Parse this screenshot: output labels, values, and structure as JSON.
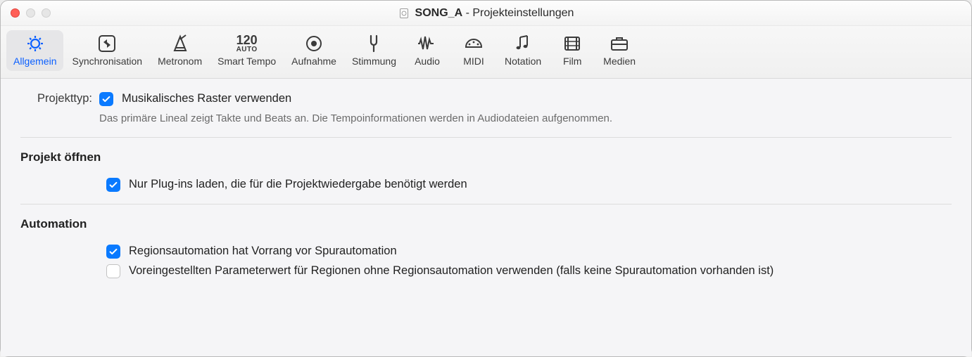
{
  "window": {
    "doc_name": "SONG_A",
    "separator": " - ",
    "title": "Projekteinstellungen"
  },
  "toolbar": {
    "items": [
      {
        "id": "general",
        "label": "Allgemein",
        "active": true
      },
      {
        "id": "sync",
        "label": "Synchronisation",
        "active": false
      },
      {
        "id": "metro",
        "label": "Metronom",
        "active": false
      },
      {
        "id": "smart",
        "label": "Smart Tempo",
        "active": false,
        "topText": "120",
        "subText": "AUTO"
      },
      {
        "id": "record",
        "label": "Aufnahme",
        "active": false
      },
      {
        "id": "tuning",
        "label": "Stimmung",
        "active": false
      },
      {
        "id": "audio",
        "label": "Audio",
        "active": false
      },
      {
        "id": "midi",
        "label": "MIDI",
        "active": false
      },
      {
        "id": "notation",
        "label": "Notation",
        "active": false
      },
      {
        "id": "film",
        "label": "Film",
        "active": false
      },
      {
        "id": "assets",
        "label": "Medien",
        "active": false
      }
    ]
  },
  "project_type": {
    "label": "Projekttyp:",
    "checkbox_label": "Musikalisches Raster verwenden",
    "checked": true,
    "help": "Das primäre Lineal zeigt Takte und Beats an. Die Tempoinformationen werden in Audiodateien aufgenommen."
  },
  "open_project": {
    "title": "Projekt öffnen",
    "checkbox_label": "Nur Plug-ins laden, die für die Projektwiedergabe benötigt werden",
    "checked": true
  },
  "automation": {
    "title": "Automation",
    "opt1_label": "Regionsautomation hat Vorrang vor Spurautomation",
    "opt1_checked": true,
    "opt2_label": "Voreingestellten Parameterwert für Regionen ohne Regionsautomation verwenden (falls keine Spurautomation vorhanden ist)",
    "opt2_checked": false
  }
}
